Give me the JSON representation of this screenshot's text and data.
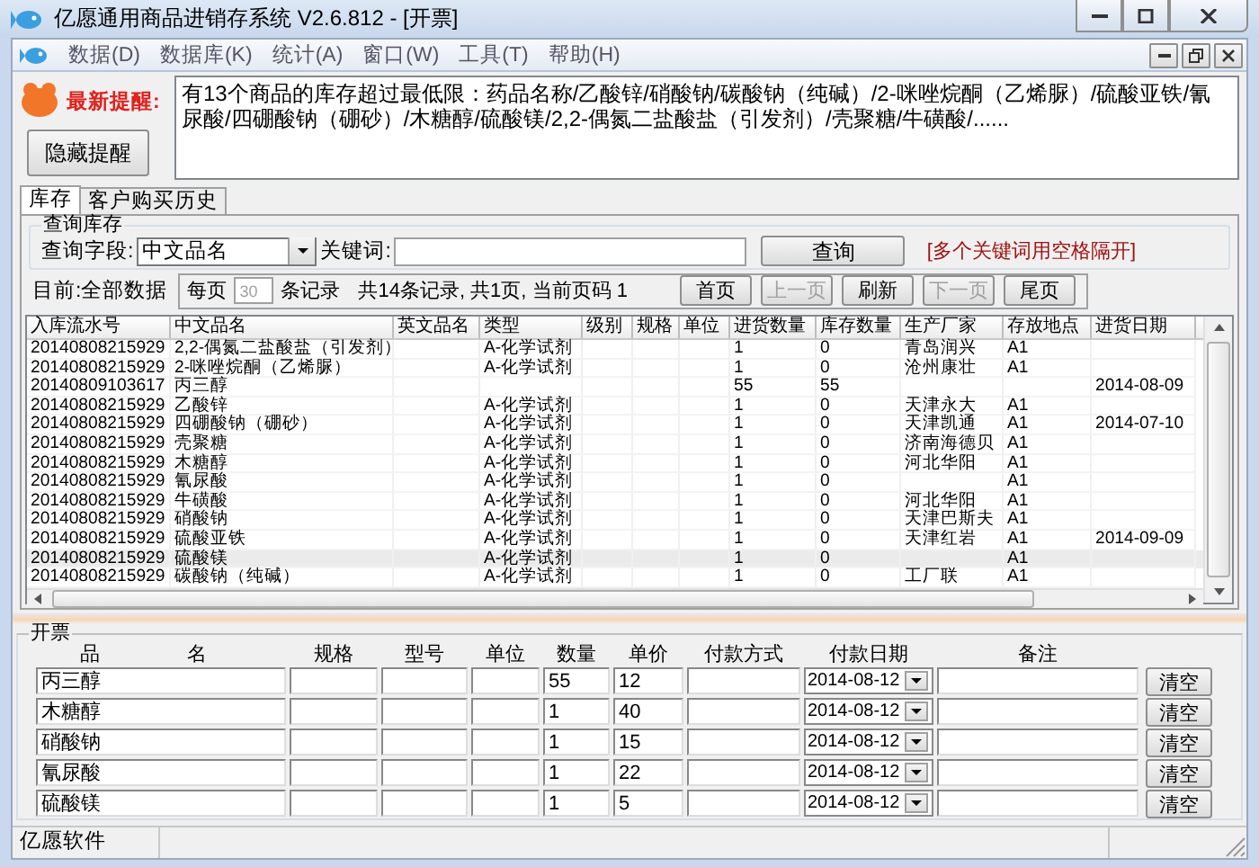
{
  "window": {
    "title": "亿愿通用商品进销存系统 V2.6.812 - [开票]"
  },
  "menu": [
    "数据(D)",
    "数据库(K)",
    "统计(A)",
    "窗口(W)",
    "工具(T)",
    "帮助(H)"
  ],
  "alert": {
    "label": "最新提醒:",
    "button": "隐藏提醒",
    "message": "有13个商品的库存超过最低限：药品名称/乙酸锌/硝酸钠/碳酸钠（纯碱）/2-咪唑烷酮（乙烯脲）/硫酸亚铁/氰尿酸/四硼酸钠（硼砂）/木糖醇/硫酸镁/2,2-偶氮二盐酸盐（引发剂）/壳聚糖/牛磺酸/......"
  },
  "tabs": [
    {
      "label": "库存",
      "selected": true
    },
    {
      "label": "客户购买历史",
      "selected": false
    }
  ],
  "query": {
    "title": "查询库存",
    "field_label": "查询字段:",
    "field_value": "中文品名",
    "keyword_label": "关键词:",
    "button": "查询",
    "hint": "[多个关键词用空格隔开]"
  },
  "pager": {
    "scope": "目前:全部数据",
    "per_page_label": "每页",
    "per_page": {
      "value": "30",
      "disabled": true
    },
    "unit": "条记录",
    "summary": "共14条记录, 共1页, 当前页码 1",
    "buttons": [
      {
        "label": "首页",
        "disabled": false
      },
      {
        "label": "上一页",
        "disabled": true
      },
      {
        "label": "刷新",
        "disabled": false
      },
      {
        "label": "下一页",
        "disabled": true
      },
      {
        "label": "尾页",
        "disabled": false
      }
    ]
  },
  "table": {
    "columns": [
      "入库流水号",
      "中文品名",
      "英文品名",
      "类型",
      "级别",
      "规格",
      "单位",
      "进货数量",
      "库存数量",
      "生产厂家",
      "存放地点",
      "进货日期"
    ],
    "rows": [
      {
        "selected": false,
        "cells": [
          "20140808215929",
          "2,2-偶氮二盐酸盐（引发剂）",
          null,
          "A-化学试剂",
          null,
          null,
          null,
          "1",
          "0",
          "青岛润兴",
          "A1",
          null
        ]
      },
      {
        "selected": false,
        "cells": [
          "20140808215929",
          "2-咪唑烷酮（乙烯脲）",
          null,
          "A-化学试剂",
          null,
          null,
          null,
          "1",
          "0",
          "沧州康壮",
          "A1",
          null
        ]
      },
      {
        "selected": false,
        "cells": [
          "20140809103617",
          "丙三醇",
          null,
          null,
          null,
          null,
          null,
          "55",
          "55",
          null,
          null,
          "2014-08-09"
        ]
      },
      {
        "selected": false,
        "cells": [
          "20140808215929",
          "乙酸锌",
          null,
          "A-化学试剂",
          null,
          null,
          null,
          "1",
          "0",
          "天津永大",
          "A1",
          null
        ]
      },
      {
        "selected": false,
        "cells": [
          "20140808215929",
          "四硼酸钠（硼砂）",
          null,
          "A-化学试剂",
          null,
          null,
          null,
          "1",
          "0",
          "天津凯通",
          "A1",
          "2014-07-10"
        ]
      },
      {
        "selected": false,
        "cells": [
          "20140808215929",
          "壳聚糖",
          null,
          "A-化学试剂",
          null,
          null,
          null,
          "1",
          "0",
          "济南海德贝",
          "A1",
          null
        ]
      },
      {
        "selected": false,
        "cells": [
          "20140808215929",
          "木糖醇",
          null,
          "A-化学试剂",
          null,
          null,
          null,
          "1",
          "0",
          "河北华阳",
          "A1",
          null
        ]
      },
      {
        "selected": false,
        "cells": [
          "20140808215929",
          "氰尿酸",
          null,
          "A-化学试剂",
          null,
          null,
          null,
          "1",
          "0",
          null,
          "A1",
          null
        ]
      },
      {
        "selected": false,
        "cells": [
          "20140808215929",
          "牛磺酸",
          null,
          "A-化学试剂",
          null,
          null,
          null,
          "1",
          "0",
          "河北华阳",
          "A1",
          null
        ]
      },
      {
        "selected": false,
        "cells": [
          "20140808215929",
          "硝酸钠",
          null,
          "A-化学试剂",
          null,
          null,
          null,
          "1",
          "0",
          "天津巴斯夫",
          "A1",
          null
        ]
      },
      {
        "selected": false,
        "cells": [
          "20140808215929",
          "硫酸亚铁",
          null,
          "A-化学试剂",
          null,
          null,
          null,
          "1",
          "0",
          "天津红岩",
          "A1",
          "2014-09-09"
        ]
      },
      {
        "selected": true,
        "cells": [
          "20140808215929",
          "硫酸镁",
          null,
          "A-化学试剂",
          null,
          null,
          null,
          "1",
          "0",
          null,
          "A1",
          null
        ]
      },
      {
        "selected": false,
        "cells": [
          "20140808215929",
          "碳酸钠（纯碱）",
          null,
          "A-化学试剂",
          null,
          null,
          null,
          "1",
          "0",
          "工厂联",
          "A1",
          null
        ]
      }
    ]
  },
  "invoice": {
    "title": "开票",
    "columns": [
      "品",
      "名",
      "规格",
      "型号",
      "单位",
      "数量",
      "单价",
      "付款方式",
      "付款日期",
      "备注"
    ],
    "rows": [
      {
        "name": "丙三醇",
        "quantity": "55",
        "price": "12",
        "date": "2014-08-12",
        "button": "清空"
      },
      {
        "name": "木糖醇",
        "quantity": "1",
        "price": "40",
        "date": "2014-08-12",
        "button": "清空"
      },
      {
        "name": "硝酸钠",
        "quantity": "1",
        "price": "15",
        "date": "2014-08-12",
        "button": "清空"
      },
      {
        "name": "氰尿酸",
        "quantity": "1",
        "price": "22",
        "date": "2014-08-12",
        "button": "清空"
      },
      {
        "name": "硫酸镁",
        "quantity": "1",
        "price": "5",
        "date": "2014-08-12",
        "button": "清空"
      }
    ]
  },
  "status_bar": {
    "text": "亿愿软件"
  }
}
